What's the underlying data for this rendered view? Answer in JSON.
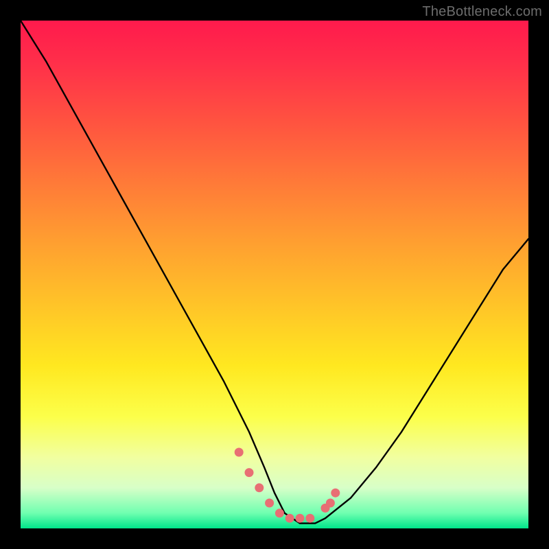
{
  "watermark": "TheBottleneck.com",
  "chart_data": {
    "type": "line",
    "title": "",
    "xlabel": "",
    "ylabel": "",
    "xlim": [
      0,
      100
    ],
    "ylim": [
      0,
      100
    ],
    "grid": false,
    "series": [
      {
        "name": "bottleneck-curve",
        "color": "#000000",
        "x": [
          0,
          5,
          10,
          15,
          20,
          25,
          30,
          35,
          40,
          45,
          48,
          50,
          52,
          55,
          58,
          60,
          65,
          70,
          75,
          80,
          85,
          90,
          95,
          100
        ],
        "values": [
          100,
          92,
          83,
          74,
          65,
          56,
          47,
          38,
          29,
          19,
          12,
          7,
          3,
          1,
          1,
          2,
          6,
          12,
          19,
          27,
          35,
          43,
          51,
          57
        ]
      },
      {
        "name": "highlight-dots",
        "color": "#e86f74",
        "x": [
          43,
          45,
          47,
          49,
          51,
          53,
          55,
          57,
          60,
          61,
          62
        ],
        "values": [
          15,
          11,
          8,
          5,
          3,
          2,
          2,
          2,
          4,
          5,
          7
        ]
      }
    ],
    "background": {
      "type": "vertical-gradient",
      "stops": [
        {
          "pos": 0.0,
          "color": "#ff1a4c"
        },
        {
          "pos": 0.3,
          "color": "#ff7a38"
        },
        {
          "pos": 0.6,
          "color": "#ffe820"
        },
        {
          "pos": 0.85,
          "color": "#f1ffa0"
        },
        {
          "pos": 1.0,
          "color": "#00e58a"
        }
      ]
    }
  }
}
